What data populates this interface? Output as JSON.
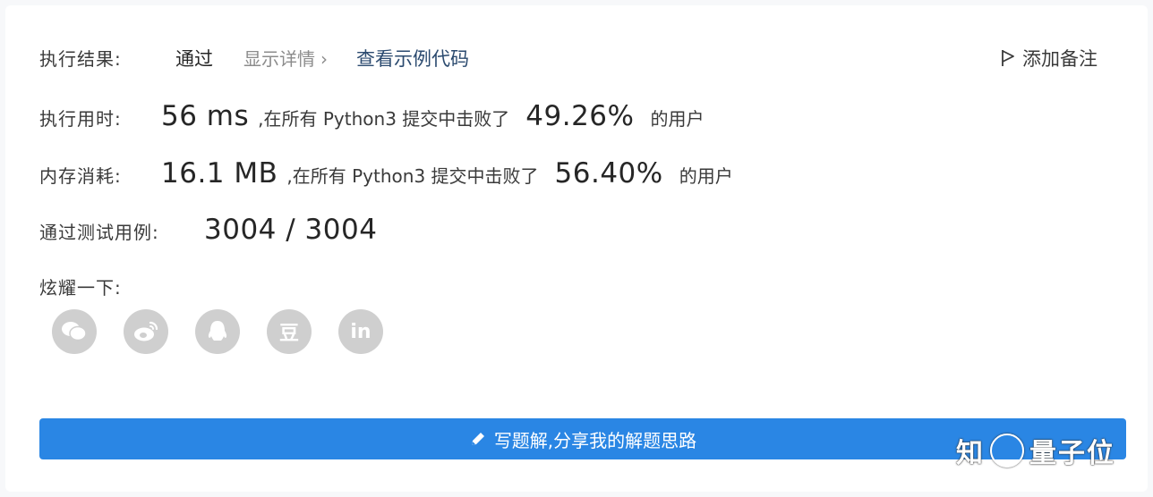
{
  "result": {
    "label": "执行结果:",
    "status": "通过",
    "details_link": "显示详情",
    "details_chevron": "›",
    "example_code_link": "查看示例代码",
    "add_note": "添加备注"
  },
  "runtime": {
    "label": "执行用时:",
    "value": "56 ms",
    "phrase": ",在所有 Python3 提交中击败了",
    "percent": "49.26%",
    "suffix": "的用户"
  },
  "memory": {
    "label": "内存消耗:",
    "value": "16.1 MB",
    "phrase": ",在所有 Python3 提交中击败了",
    "percent": "56.40%",
    "suffix": "的用户"
  },
  "tests": {
    "label": "通过测试用例:",
    "value": "3004 / 3004"
  },
  "share": {
    "label": "炫耀一下:",
    "icons": [
      "wechat-icon",
      "weibo-icon",
      "qq-icon",
      "douban-icon",
      "linkedin-icon"
    ],
    "douban_glyph": "豆",
    "linkedin_glyph": "in"
  },
  "cta": {
    "label": "写题解,分享我的解题思路"
  },
  "watermark": {
    "left": "知",
    "right": "量子位"
  },
  "colors": {
    "accent": "#2a86e4",
    "link": "#2b4a6f",
    "muted": "#8c8c8c",
    "share_icon": "#cfcfcf"
  }
}
